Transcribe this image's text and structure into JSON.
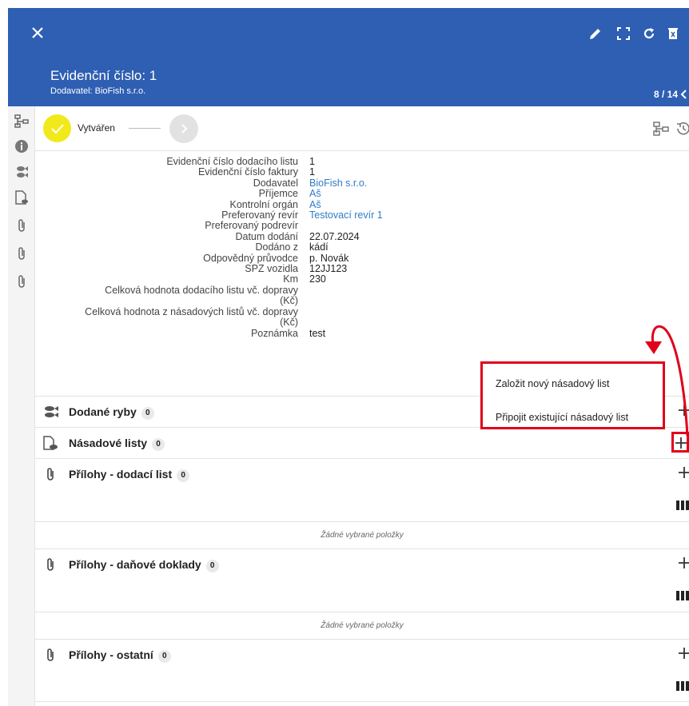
{
  "header": {
    "title": "Evidenční číslo: 1",
    "subtitle": "Dodavatel: BioFish s.r.o.",
    "pager": "8 / 14",
    "bg_color": "#2f5fb3"
  },
  "toolbar": {
    "icons": [
      "close-icon",
      "pencil-icon",
      "fullscreen-icon",
      "refresh-icon",
      "delete-icon"
    ]
  },
  "sidebar": {
    "icons": [
      "tree-icon",
      "info-icon",
      "fish-icon",
      "document-fish-icon",
      "paperclip-icon",
      "paperclip-icon",
      "paperclip-icon"
    ]
  },
  "workflow": {
    "step_done_label": "Vytvářen",
    "step_done_color": "#f1e91b"
  },
  "fields": [
    {
      "label": "Evidenční číslo dodacího listu",
      "value": "1"
    },
    {
      "label": "Evidenční číslo faktury",
      "value": "1"
    },
    {
      "label": "Dodavatel",
      "value": "BioFish s.r.o.",
      "link": true
    },
    {
      "label": "Příjemce",
      "value": "Aš",
      "link": true
    },
    {
      "label": "Kontrolní orgán",
      "value": "Aš",
      "link": true
    },
    {
      "label": "Preferovaný revír",
      "value": "Testovací revír 1",
      "link": true
    },
    {
      "label": "Preferovaný podrevír",
      "value": ""
    },
    {
      "label": "Datum dodání",
      "value": "22.07.2024"
    },
    {
      "label": "Dodáno z",
      "value": "kádí"
    },
    {
      "label": "Odpovědný průvodce",
      "value": "p. Novák"
    },
    {
      "label": "SPZ vozidla",
      "value": "12JJ123"
    },
    {
      "label": "Km",
      "value": "230"
    },
    {
      "label": "Celková hodnota dodacího listu vč. dopravy\n(Kč)",
      "value": ""
    },
    {
      "label": "Celková hodnota z násadových listů vč. dopravy\n(Kč)",
      "value": ""
    },
    {
      "label": "Poznámka",
      "value": "test"
    }
  ],
  "sections": [
    {
      "title": "Dodané ryby",
      "count": "0"
    },
    {
      "title": "Násadové listy",
      "count": "0"
    },
    {
      "title": "Přílohy - dodací list",
      "count": "0",
      "empty_text": "Žádné vybrané položky"
    },
    {
      "title": "Přílohy - daňové doklady",
      "count": "0",
      "empty_text": "Žádné vybrané položky"
    },
    {
      "title": "Přílohy - ostatní",
      "count": "0"
    }
  ],
  "popup": {
    "items": [
      "Založit nový násadový list",
      "Připojit existující násadový list"
    ],
    "highlight_color": "#e0001a"
  },
  "link_color": "#2f7bc8"
}
